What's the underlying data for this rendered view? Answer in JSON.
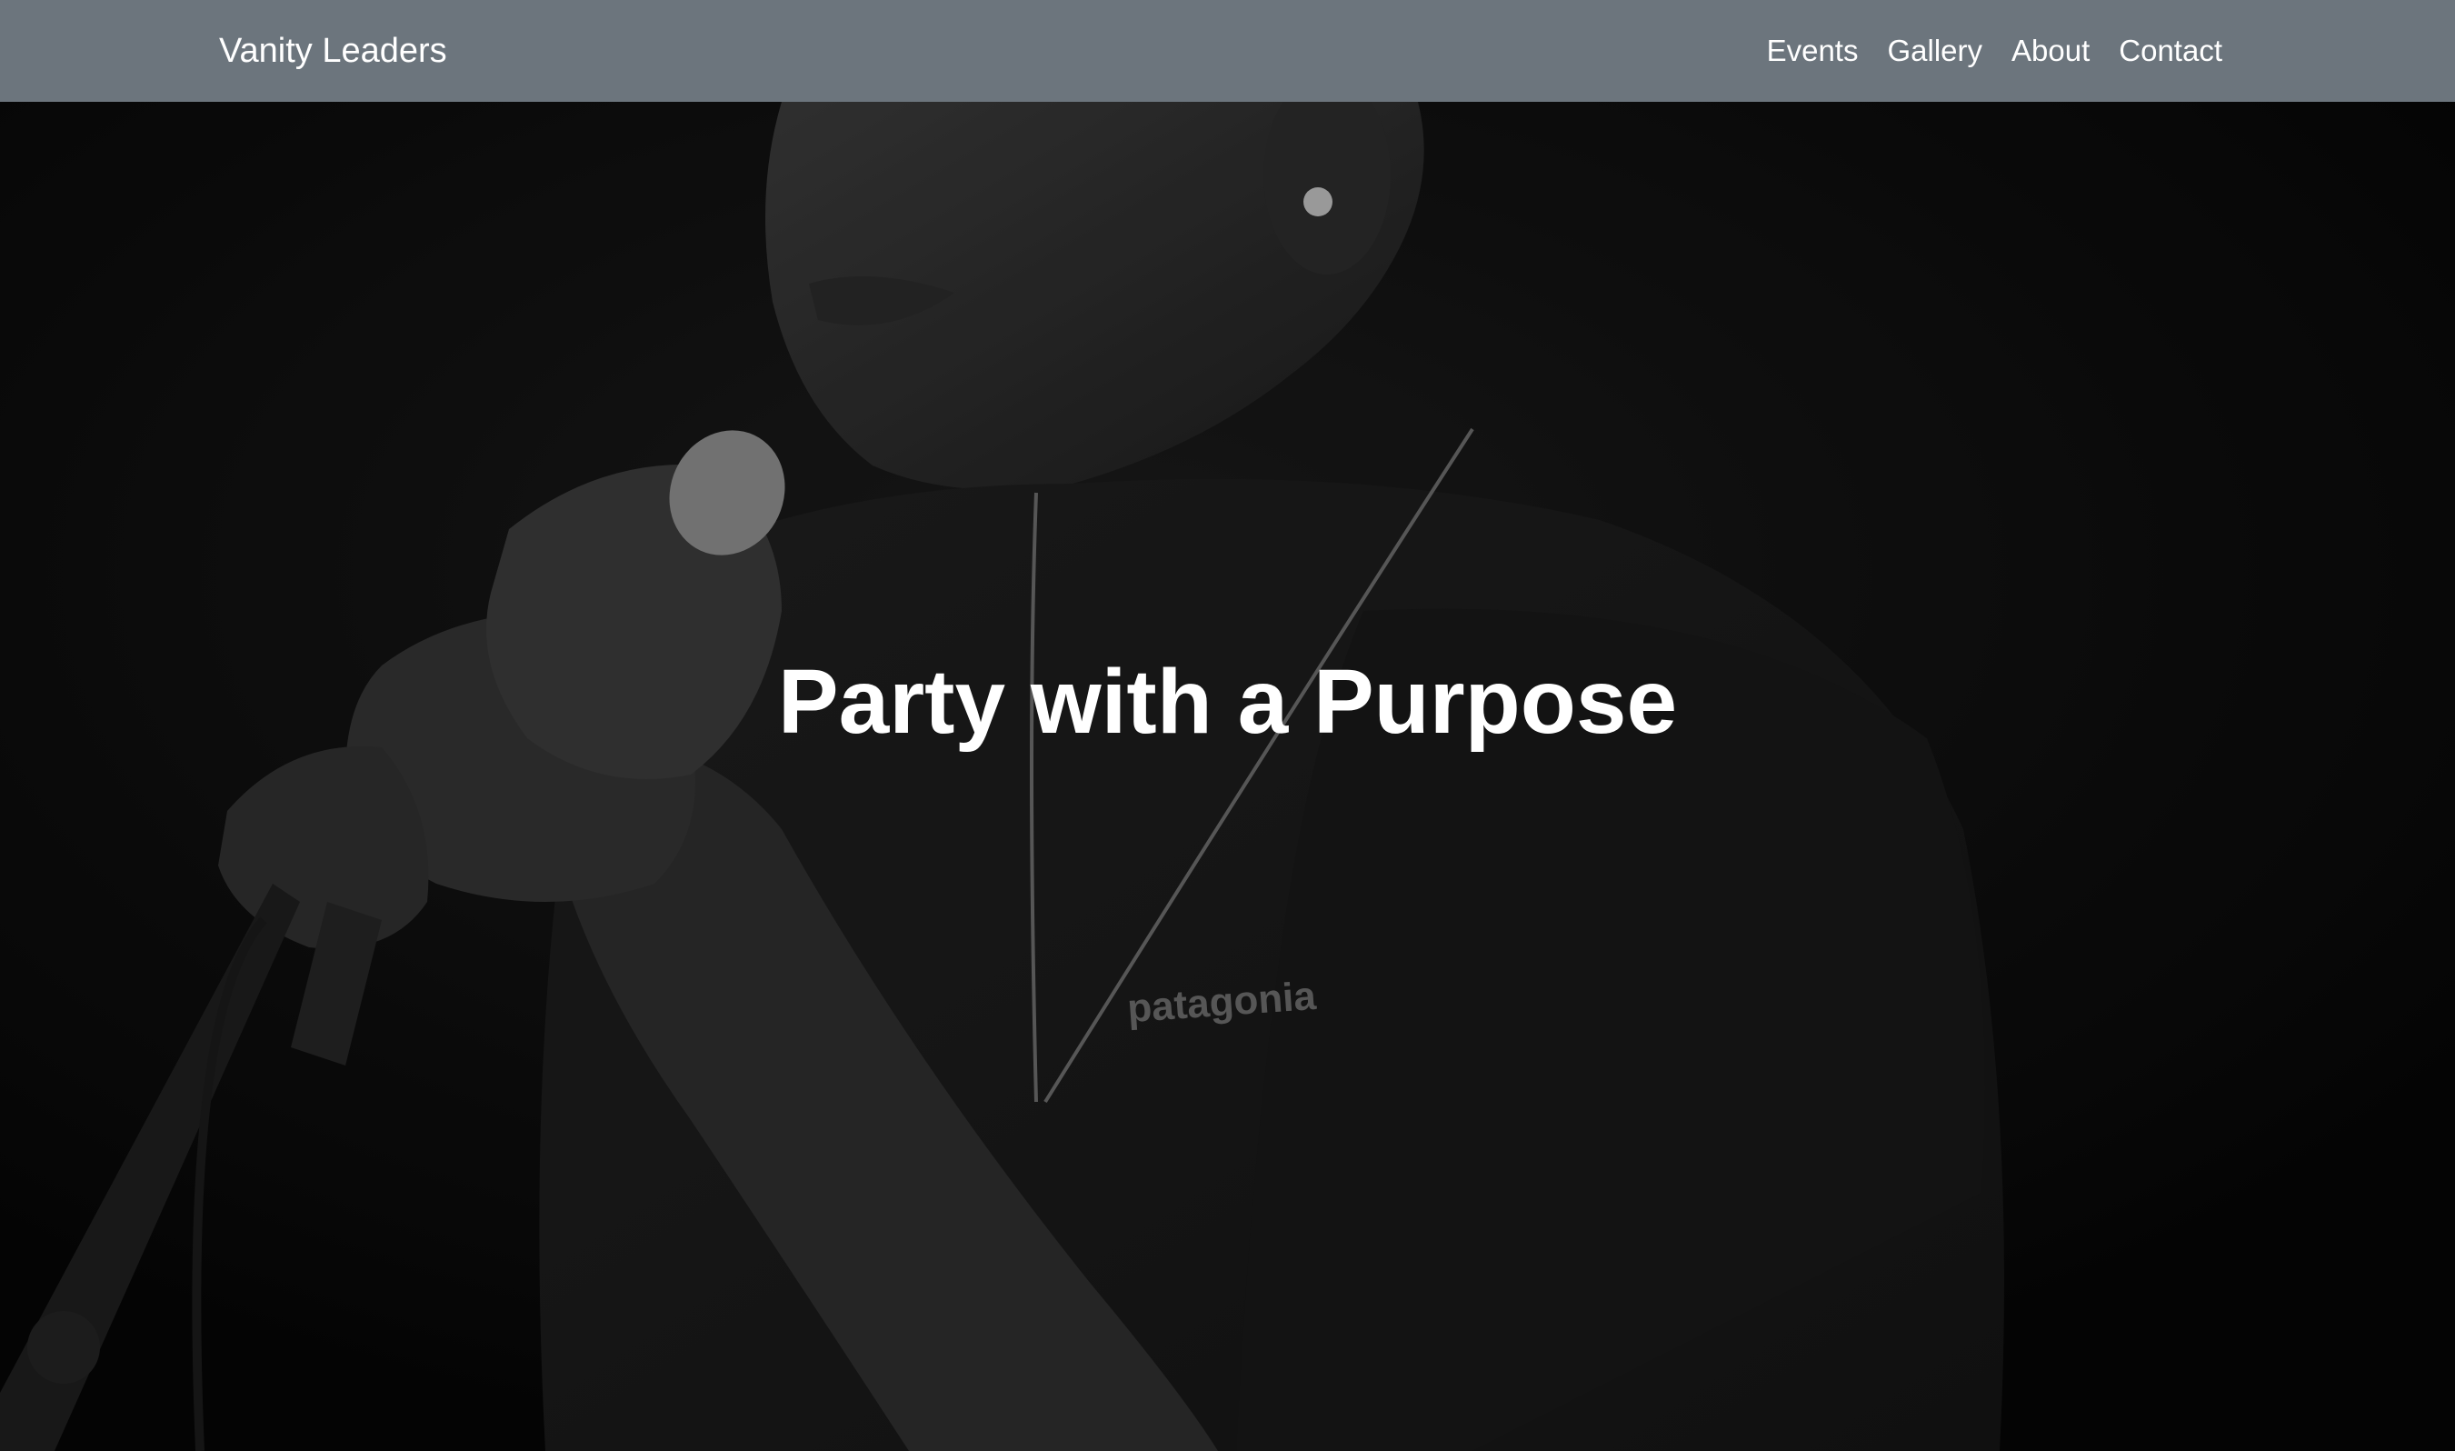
{
  "navbar": {
    "brand": "Vanity Leaders",
    "links": [
      {
        "label": "Events"
      },
      {
        "label": "Gallery"
      },
      {
        "label": "About"
      },
      {
        "label": "Contact"
      }
    ]
  },
  "hero": {
    "title": "Party with a Purpose",
    "shirt_logo_text": "patagonia"
  },
  "colors": {
    "navbar_bg": "#6c757d",
    "text": "#ffffff",
    "hero_bg": "#050505"
  }
}
